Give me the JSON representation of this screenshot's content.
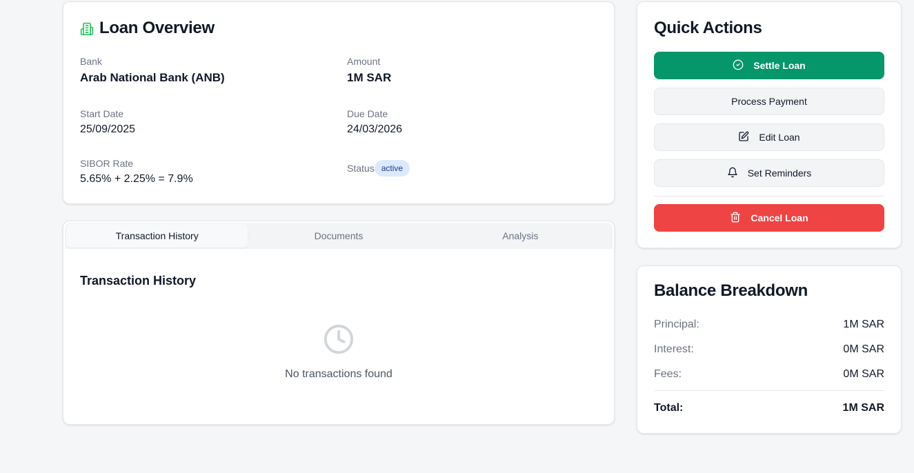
{
  "overview": {
    "title": "Loan Overview",
    "icon": "building-icon",
    "fields": {
      "bank": {
        "label": "Bank",
        "value": "Arab National Bank (ANB)"
      },
      "amount": {
        "label": "Amount",
        "value": "1M SAR"
      },
      "start_date": {
        "label": "Start Date",
        "value": "25/09/2025"
      },
      "due_date": {
        "label": "Due Date",
        "value": "24/03/2026"
      },
      "sibor": {
        "label": "SIBOR Rate",
        "value": "5.65% + 2.25% = 7.9%"
      },
      "status": {
        "label": "Status",
        "value": "active"
      }
    }
  },
  "tabs": {
    "items": [
      "Transaction History",
      "Documents",
      "Analysis"
    ],
    "active": "Transaction History"
  },
  "transactions": {
    "title": "Transaction History",
    "empty_icon": "clock-icon",
    "empty_message": "No transactions found"
  },
  "quick_actions": {
    "title": "Quick Actions",
    "settle": "Settle Loan",
    "process": "Process Payment",
    "edit": "Edit Loan",
    "reminders": "Set Reminders",
    "cancel": "Cancel Loan"
  },
  "balance": {
    "title": "Balance Breakdown",
    "principal": {
      "label": "Principal:",
      "value": "1M SAR"
    },
    "interest": {
      "label": "Interest:",
      "value": "0M SAR"
    },
    "fees": {
      "label": "Fees:",
      "value": "0M SAR"
    },
    "total": {
      "label": "Total:",
      "value": "1M SAR"
    }
  },
  "colors": {
    "accent_green": "#059669",
    "danger_red": "#ef4444",
    "badge_bg": "#dbeafe",
    "icon_green": "#16a34a"
  }
}
